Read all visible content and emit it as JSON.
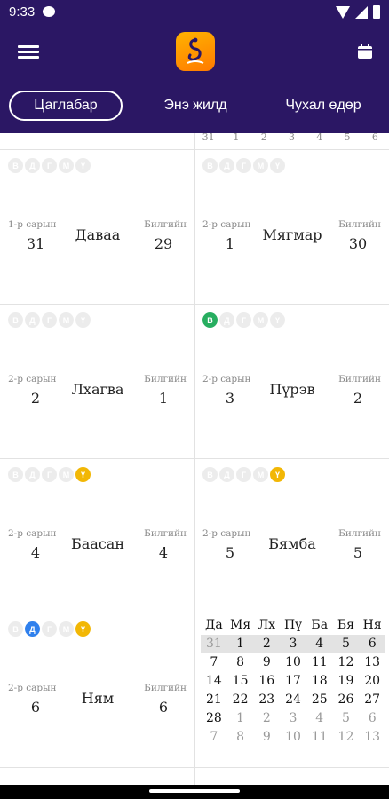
{
  "status": {
    "time": "9:33"
  },
  "tabs": [
    {
      "label": "Цаглабар",
      "active": true
    },
    {
      "label": "Энэ жилд",
      "active": false
    },
    {
      "label": "Чухал өдөр",
      "active": false
    }
  ],
  "top_strip": [
    "31",
    "1",
    "2",
    "3",
    "4",
    "5",
    "6"
  ],
  "days": [
    {
      "badges": [
        "В",
        "Д",
        "Г",
        "М",
        "Ү"
      ],
      "active_badges": [],
      "lunar_label": "1-р сарын",
      "lunar": "31",
      "name": "Даваа",
      "solar_label": "Билгийн",
      "solar": "29"
    },
    {
      "badges": [
        "В",
        "Д",
        "Г",
        "М",
        "Ү"
      ],
      "active_badges": [],
      "lunar_label": "2-р сарын",
      "lunar": "1",
      "name": "Мягмар",
      "solar_label": "Билгийн",
      "solar": "30"
    },
    {
      "badges": [
        "В",
        "Д",
        "Г",
        "М",
        "Ү"
      ],
      "active_badges": [],
      "lunar_label": "2-р сарын",
      "lunar": "2",
      "name": "Лхагва",
      "solar_label": "Билгийн",
      "solar": "1"
    },
    {
      "badges": [
        "В",
        "Д",
        "Г",
        "М",
        "Ү"
      ],
      "active_badges": [
        "В"
      ],
      "lunar_label": "2-р сарын",
      "lunar": "3",
      "name": "Пүрэв",
      "solar_label": "Билгийн",
      "solar": "2"
    },
    {
      "badges": [
        "В",
        "Д",
        "Г",
        "М",
        "Ү"
      ],
      "active_badges": [
        "Ү"
      ],
      "lunar_label": "2-р сарын",
      "lunar": "4",
      "name": "Баасан",
      "solar_label": "Билгийн",
      "solar": "4"
    },
    {
      "badges": [
        "В",
        "Д",
        "Г",
        "М",
        "Ү"
      ],
      "active_badges": [
        "Ү"
      ],
      "lunar_label": "2-р сарын",
      "lunar": "5",
      "name": "Бямба",
      "solar_label": "Билгийн",
      "solar": "5"
    },
    {
      "badges": [
        "В",
        "Д",
        "Г",
        "М",
        "Ү"
      ],
      "active_badges": [
        "Д",
        "Ү"
      ],
      "lunar_label": "2-р сарын",
      "lunar": "6",
      "name": "Ням",
      "solar_label": "Билгийн",
      "solar": "6"
    }
  ],
  "badge_colors": {
    "В": "#27ae60",
    "Д": "#2f80ed",
    "Ү": "#f2b705",
    "inactive": "#ececec"
  },
  "minical": {
    "headers": [
      "Да",
      "Мя",
      "Лх",
      "Пү",
      "Ба",
      "Бя",
      "Ня"
    ],
    "weeks": [
      [
        "31",
        "1",
        "2",
        "3",
        "4",
        "5",
        "6"
      ],
      [
        "7",
        "8",
        "9",
        "10",
        "11",
        "12",
        "13"
      ],
      [
        "14",
        "15",
        "16",
        "17",
        "18",
        "19",
        "20"
      ],
      [
        "21",
        "22",
        "23",
        "24",
        "25",
        "26",
        "27"
      ],
      [
        "28",
        "1",
        "2",
        "3",
        "4",
        "5",
        "6"
      ],
      [
        "7",
        "8",
        "9",
        "10",
        "11",
        "12",
        "13"
      ]
    ],
    "highlight_week": 0
  },
  "colors": {
    "header_bg": "#2b1764",
    "logo": "#ff9800"
  }
}
